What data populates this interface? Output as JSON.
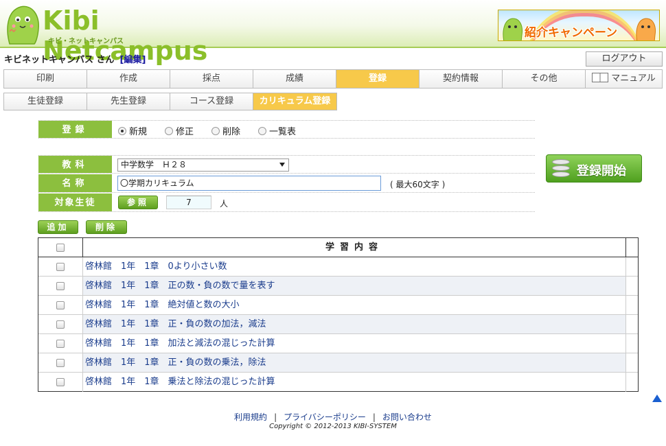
{
  "header": {
    "logo_text": "Kibi Netcampus",
    "logo_sub": "キビ・ネットキャンパス",
    "campaign_label": "紹介キャンペーン"
  },
  "user": {
    "name": "キビネットキャンパス さん",
    "edit_label": "[編集]",
    "logout_label": "ログアウト"
  },
  "nav": {
    "items": [
      "印刷",
      "作成",
      "採点",
      "成績",
      "登録",
      "契約情報",
      "その他",
      "マニュアル"
    ],
    "active": "登録"
  },
  "subnav": {
    "items": [
      "生徒登録",
      "先生登録",
      "コース登録",
      "カリキュラム登録"
    ],
    "active": "カリキュラム登録"
  },
  "form": {
    "mode_label": "登録",
    "modes": [
      "新規",
      "修正",
      "削除",
      "一覧表"
    ],
    "mode_selected": "新規",
    "subject_label": "教科",
    "subject_value": "中学数学　Ｈ２８",
    "name_label": "名称",
    "name_value": "〇学期カリキュラム",
    "name_hint": "( 最大60文字 )",
    "target_label": "対象生徒",
    "ref_button": "参照",
    "target_count": "7",
    "target_unit": "人",
    "start_button": "登録開始",
    "add_button": "追加",
    "delete_button": "削除"
  },
  "table": {
    "header": "学習内容",
    "rows": [
      "啓林館　1年　1章　0より小さい数",
      "啓林館　1年　1章　正の数・負の数で量を表す",
      "啓林館　1年　1章　絶対値と数の大小",
      "啓林館　1年　1章　正・負の数の加法，減法",
      "啓林館　1年　1章　加法と減法の混じった計算",
      "啓林館　1年　1章　正・負の数の乗法，除法",
      "啓林館　1年　1章　乗法と除法の混じった計算"
    ]
  },
  "footer": {
    "links": [
      "利用規約",
      "プライバシーポリシー",
      "お問い合わせ"
    ],
    "copyright": "Copyright © 2012-2013 KIBI-SYSTEM"
  },
  "colors": {
    "accent_green": "#8cbf3e",
    "active_tab": "#f7c94a",
    "link_blue": "#1a3c8c"
  }
}
